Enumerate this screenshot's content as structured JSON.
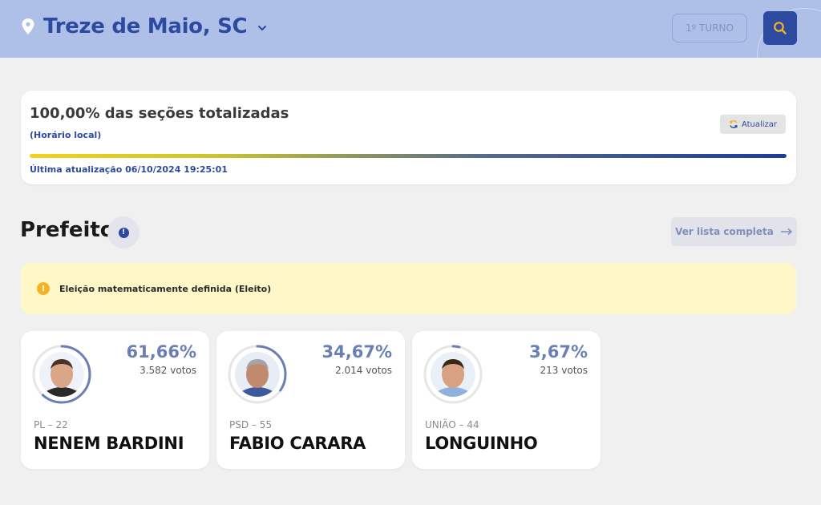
{
  "header": {
    "city": "Treze de Maio, SC",
    "turno_label": "1º TURNO",
    "colors": {
      "bar": "#aec0e8",
      "accent": "#2c4aa0",
      "search_icon": "#f3b423"
    },
    "icons": {
      "location": "map-pin-icon",
      "dropdown": "chevron-down-icon",
      "search": "search-icon"
    }
  },
  "status": {
    "sections_text": "100,00% das seções totalizadas",
    "local_time_label": "(Horário local)",
    "refresh_label": "Atualizar",
    "progress_fraction": 1.0,
    "last_update": "Última atualização 06/10/2024 19:25:01"
  },
  "section": {
    "title": "Prefeito",
    "info_icon": "info-icon",
    "see_all_label": "Ver lista completa"
  },
  "alert": {
    "text": "Eleição matematicamente definida (Eleito)",
    "icon": "warning-icon",
    "color": "#fef8c8"
  },
  "candidates": [
    {
      "percent": "61,66%",
      "votes": "3.582 votos",
      "party": "PL – 22",
      "name": "NENEM BARDINI",
      "share": 0.6166,
      "skin": "#d9a688",
      "hair": "#4a3326",
      "shirt": "#2a2a2a",
      "bg": "#eff2f8"
    },
    {
      "percent": "34,67%",
      "votes": "2.014 votos",
      "party": "PSD – 55",
      "name": "FABIO CARARA",
      "share": 0.3467,
      "skin": "#c08a6e",
      "hair": "#a4a4a4",
      "shirt": "#3d5a9c",
      "bg": "#e8ecf5"
    },
    {
      "percent": "3,67%",
      "votes": "213 votos",
      "party": "UNIÃO – 44",
      "name": "LONGUINHO",
      "share": 0.0367,
      "skin": "#d8a183",
      "hair": "#3a2718",
      "shirt": "#8fb1dc",
      "bg": "#eaf0f7"
    }
  ]
}
